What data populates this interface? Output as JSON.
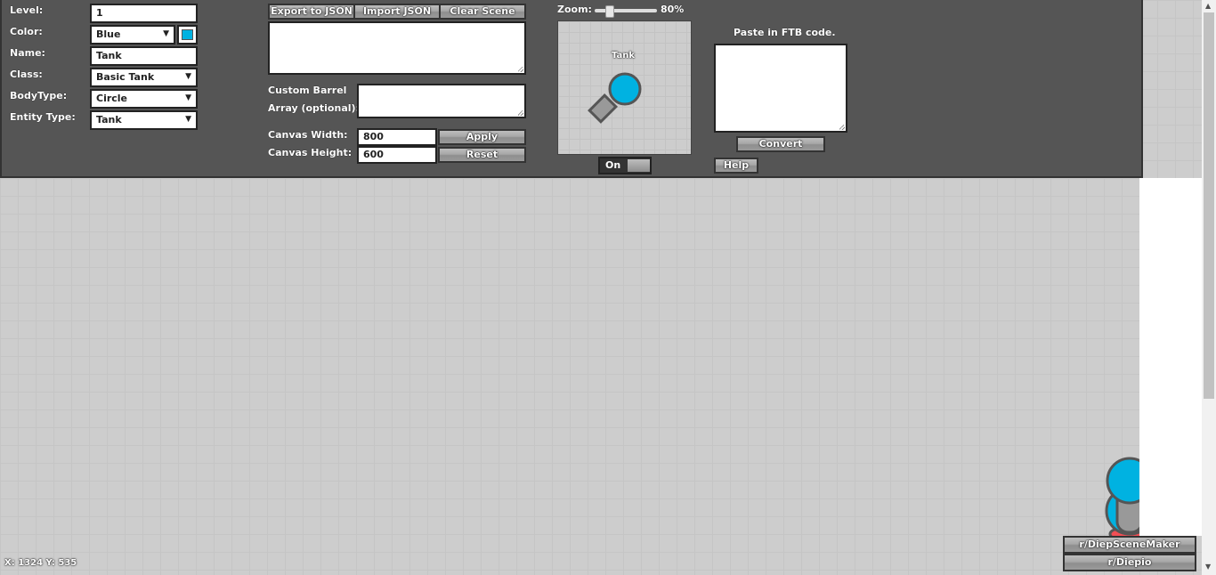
{
  "form": {
    "level_label": "Level:",
    "level_value": "1",
    "color_label": "Color:",
    "color_value": "Blue",
    "color_swatch": "#00b2e1",
    "name_label": "Name:",
    "name_value": "Tank",
    "class_label": "Class:",
    "class_value": "Basic Tank",
    "bodytype_label": "BodyType:",
    "bodytype_value": "Circle",
    "entity_label": "Entity Type:",
    "entity_value": "Tank"
  },
  "json_tools": {
    "export_label": "Export to JSON",
    "import_label": "Import JSON",
    "clear_label": "Clear Scene",
    "textarea_value": ""
  },
  "barrel": {
    "label_line1": "Custom Barrel",
    "label_line2": "Array (optional):",
    "value": ""
  },
  "canvas": {
    "width_label": "Canvas Width:",
    "width_value": "800",
    "height_label": "Canvas Height:",
    "height_value": "600",
    "apply_label": "Apply",
    "reset_label": "Reset"
  },
  "zoom": {
    "label": "Zoom:",
    "value_text": "80%",
    "fraction": 0.2
  },
  "preview": {
    "tank_name": "Tank",
    "toggle_label": "On"
  },
  "ftb": {
    "title": "Paste in FTB code.",
    "value": "",
    "convert_label": "Convert",
    "help_label": "Help"
  },
  "footer": {
    "coords": "X: 1324 Y: 535",
    "link1": "r/DiepSceneMaker",
    "link2": "r/Diepio"
  },
  "colors": {
    "panel_bg": "#555555",
    "tank_blue": "#00b2e1",
    "barrel_gray": "#999999",
    "tank_red": "#f14e54"
  }
}
